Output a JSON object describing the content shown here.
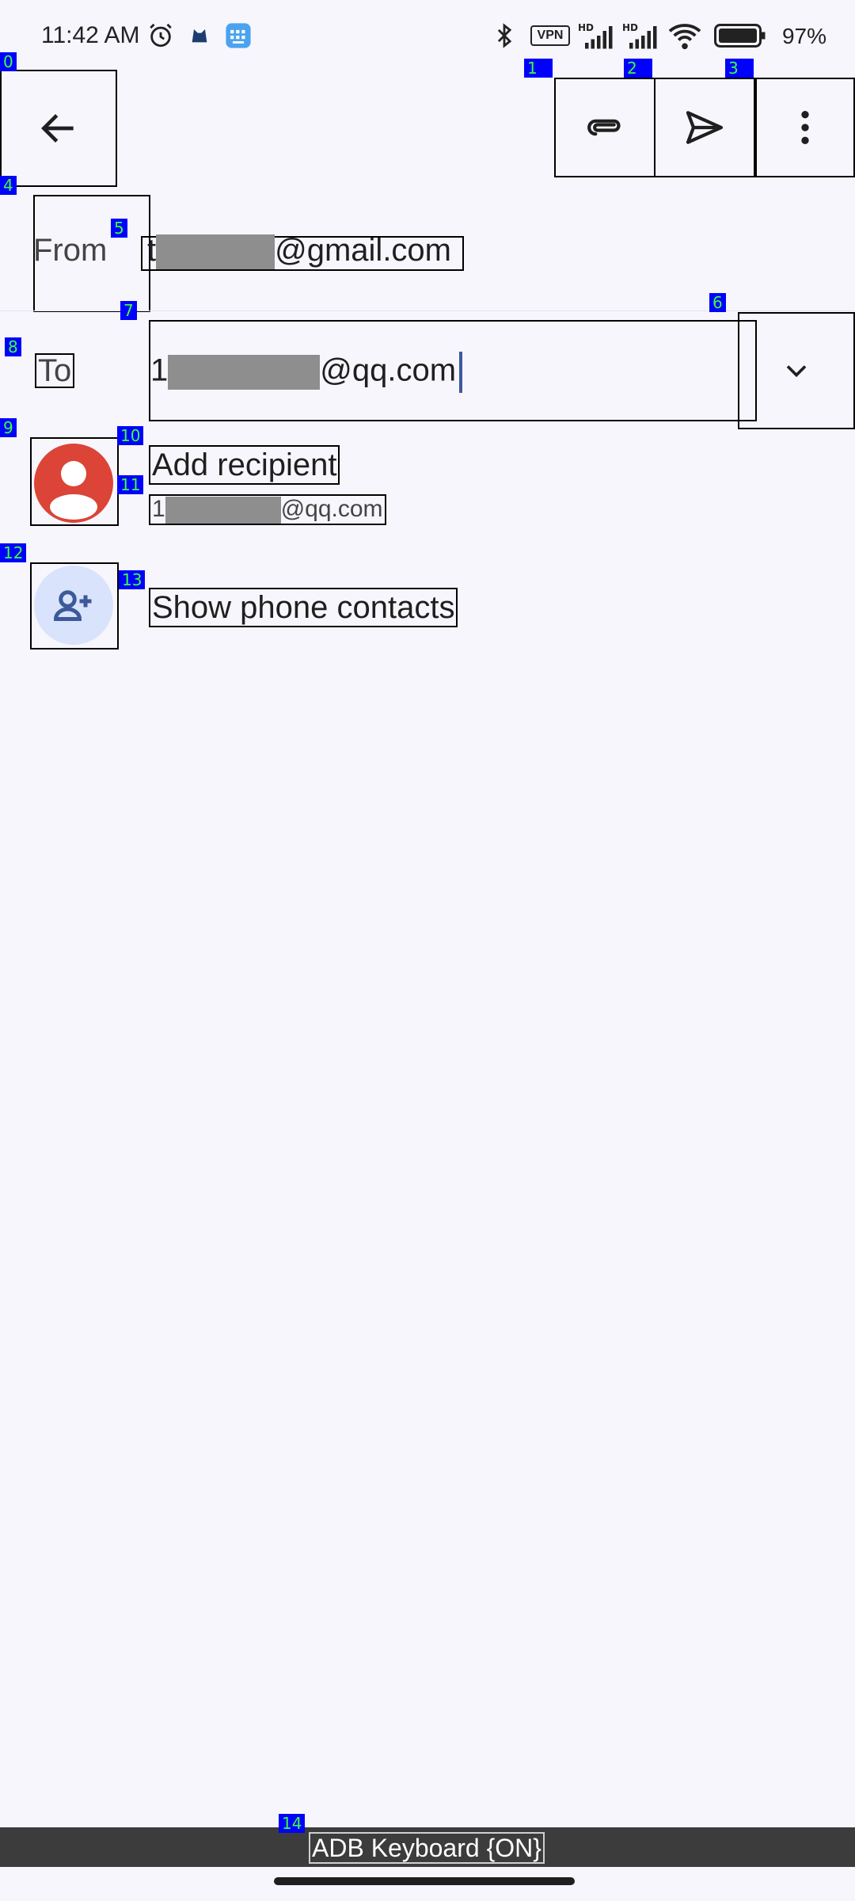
{
  "status_bar": {
    "time": "11:42 AM",
    "battery_percent": "97%",
    "icons": [
      "alarm-icon",
      "cat-icon",
      "keyboard-app-icon",
      "bluetooth-icon",
      "vpn-icon",
      "hd-signal-icon",
      "hd-signal-icon",
      "wifi-icon",
      "battery-icon"
    ],
    "vpn_label": "VPN"
  },
  "toolbar": {
    "back_icon": "arrow-left-icon",
    "attach_icon": "paperclip-icon",
    "send_icon": "send-icon",
    "more_icon": "more-vert-icon"
  },
  "compose": {
    "from_label": "From",
    "from_prefix": "t",
    "from_suffix": "@gmail.com",
    "to_label": "To",
    "to_prefix": "1",
    "to_suffix": "@qq.com",
    "expand_icon": "chevron-down-icon"
  },
  "suggestions": {
    "add_recipient": "Add recipient",
    "suggestion_prefix": "1",
    "suggestion_suffix": "@qq.com",
    "show_contacts": "Show phone contacts"
  },
  "overlay_tags": [
    "0",
    "1",
    "2",
    "3",
    "4",
    "5",
    "6",
    "7",
    "8",
    "9",
    "10",
    "11",
    "12",
    "13",
    "14"
  ],
  "keyboard": {
    "label": "ADB Keyboard {ON}"
  },
  "colors": {
    "background": "#f7f6fd",
    "avatar_red": "#db4437",
    "avatar_blue": "#d9e3fb",
    "accent_icon": "#3c5a9a",
    "cursor": "#3c5a9a"
  }
}
